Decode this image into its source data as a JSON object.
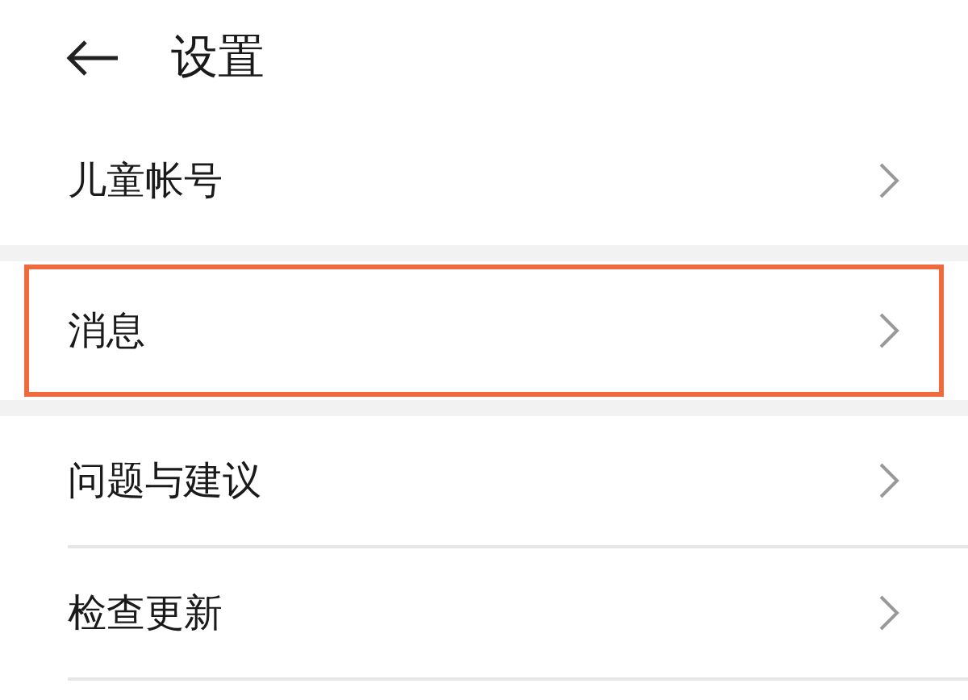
{
  "header": {
    "title": "设置"
  },
  "groups": [
    {
      "items": [
        {
          "label": "儿童帐号",
          "highlighted": false
        }
      ]
    },
    {
      "items": [
        {
          "label": "消息",
          "highlighted": true
        }
      ]
    },
    {
      "items": [
        {
          "label": "问题与建议",
          "highlighted": false
        },
        {
          "label": "检查更新",
          "highlighted": false
        }
      ]
    }
  ]
}
